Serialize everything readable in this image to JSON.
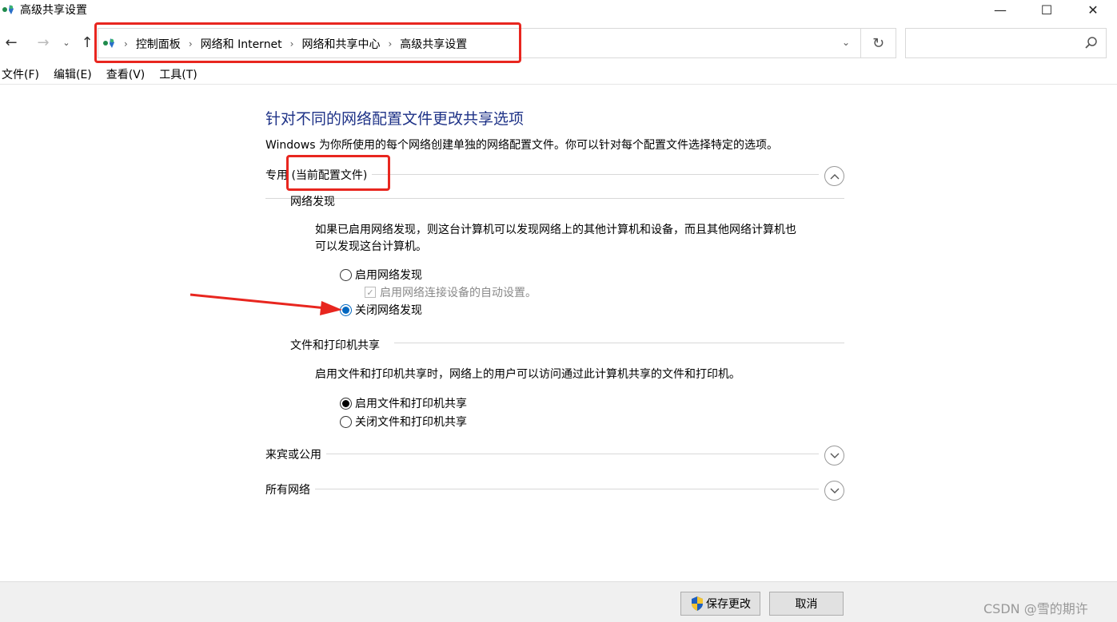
{
  "window": {
    "title": "高级共享设置",
    "minimize_glyph": "—",
    "maximize_glyph": "☐",
    "close_glyph": "✕"
  },
  "nav": {
    "back_glyph": "←",
    "forward_glyph": "→",
    "history_glyph": "⌄",
    "up_glyph": "↑",
    "breadcrumbs": [
      "控制面板",
      "网络和 Internet",
      "网络和共享中心",
      "高级共享设置"
    ],
    "crumb_separator": "›",
    "dropdown_glyph": "⌄",
    "refresh_glyph": "↻",
    "search_placeholder": ""
  },
  "menu": [
    "文件(F)",
    "编辑(E)",
    "查看(V)",
    "工具(T)"
  ],
  "main": {
    "heading": "针对不同的网络配置文件更改共享选项",
    "description": "Windows 为你所使用的每个网络创建单独的网络配置文件。你可以针对每个配置文件选择特定的选项。",
    "private_profile": {
      "label_prefix": "专用",
      "label_current": "(当前配置文件)",
      "expanded": true,
      "network_discovery": {
        "title": "网络发现",
        "text_line1": "如果已启用网络发现，则这台计算机可以发现网络上的其他计算机和设备，而且其他网络计算机也",
        "text_line2": "可以发现这台计算机。",
        "option_on": "启用网络发现",
        "auto_setup": "启用网络连接设备的自动设置。",
        "option_off": "关闭网络发现",
        "selected": "off"
      },
      "file_printer_sharing": {
        "title": "文件和打印机共享",
        "text": "启用文件和打印机共享时，网络上的用户可以访问通过此计算机共享的文件和打印机。",
        "option_on": "启用文件和打印机共享",
        "option_off": "关闭文件和打印机共享",
        "selected": "on"
      }
    },
    "guest_public": {
      "label": "来宾或公用",
      "expanded": false
    },
    "all_networks": {
      "label": "所有网络",
      "expanded": false
    }
  },
  "footer": {
    "save_label": "保存更改",
    "cancel_label": "取消",
    "watermark": "CSDN @雪的期许"
  },
  "colors": {
    "heading": "#1e3287",
    "annotation_red": "#e8261f",
    "selected_radio": "#0067c0"
  }
}
